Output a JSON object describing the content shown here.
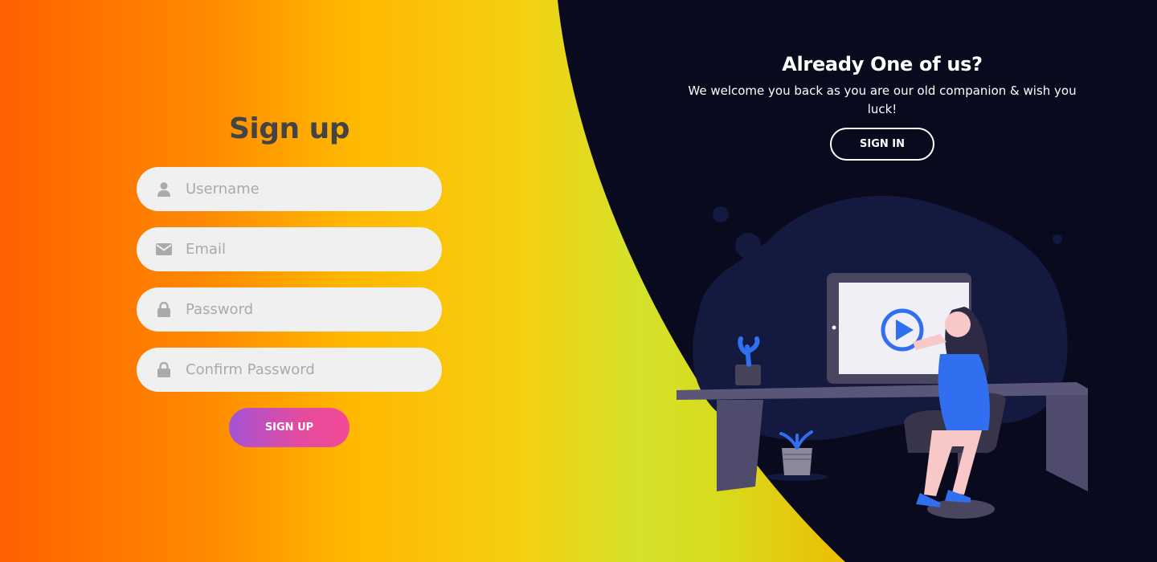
{
  "colors": {
    "dark_panel": "#0a0a1e",
    "blob": "#13193f",
    "accent_blue": "#2f6ff0",
    "signup_gradient_start": "#a453d6",
    "signup_gradient_end": "#f24a94"
  },
  "signup": {
    "title": "Sign up",
    "fields": [
      {
        "icon": "user-icon",
        "placeholder": "Username"
      },
      {
        "icon": "envelope-icon",
        "placeholder": "Email"
      },
      {
        "icon": "lock-icon",
        "placeholder": "Password"
      },
      {
        "icon": "lock-icon",
        "placeholder": "Confirm Password"
      }
    ],
    "button_label": "SIGN UP"
  },
  "panel": {
    "title": "Already One of us?",
    "text": "We welcome you back as you are our old companion & wish you luck!",
    "button_label": "SIGN IN"
  }
}
